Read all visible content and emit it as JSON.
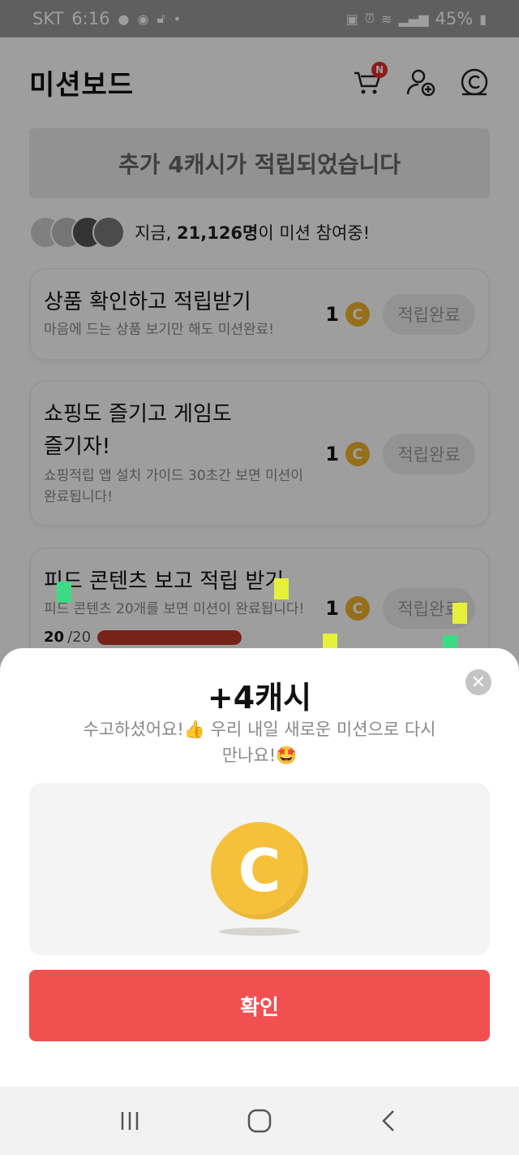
{
  "status_bar": {
    "carrier": "SKT",
    "time": "6:16",
    "battery": "45%"
  },
  "header": {
    "title": "미션보드",
    "cart_badge": "N",
    "icons": [
      "cart-icon",
      "add-friend-icon",
      "cash-coin-icon"
    ]
  },
  "banner": {
    "text": "추가 4캐시가 적립되었습니다"
  },
  "participants": {
    "prefix": "지금, ",
    "count": "21,126명",
    "suffix": "이 미션 참여중!"
  },
  "missions": [
    {
      "title": "상품 확인하고 적립받기",
      "desc": "마음에 드는 상품 보기만 해도 미션완료!",
      "reward": "1",
      "button": "적립완료"
    },
    {
      "title_line1": "쇼핑도 즐기고 게임도",
      "title_line2": "즐기자!",
      "desc_line1": "쇼핑적립 앱 설치 가이드 30초간 보면 미션이",
      "desc_line2": "완료됩니다!",
      "reward": "1",
      "button": "적립완료"
    },
    {
      "title": "피드 콘텐츠 보고 적립 받기",
      "desc": "피드 콘텐츠 20개를 보면 미션이 완료됩니다!",
      "reward": "1",
      "button": "적립완료",
      "progress_current": "20",
      "progress_total": "/20",
      "progress_fraction": 1.0
    }
  ],
  "modal": {
    "title": "+4캐시",
    "message_line1": "수고하셨어요!👍 우리 내일 새로운 미션으로 다시",
    "message_line2": "만나요!🤩",
    "coin_symbol": "C",
    "confirm": "확인"
  },
  "nav": {
    "icons": [
      "recent-apps-icon",
      "home-icon",
      "back-icon"
    ]
  },
  "colors": {
    "accent_red": "#f05050",
    "coin_gold": "#f5c13b",
    "progress_red": "#c0392b"
  }
}
